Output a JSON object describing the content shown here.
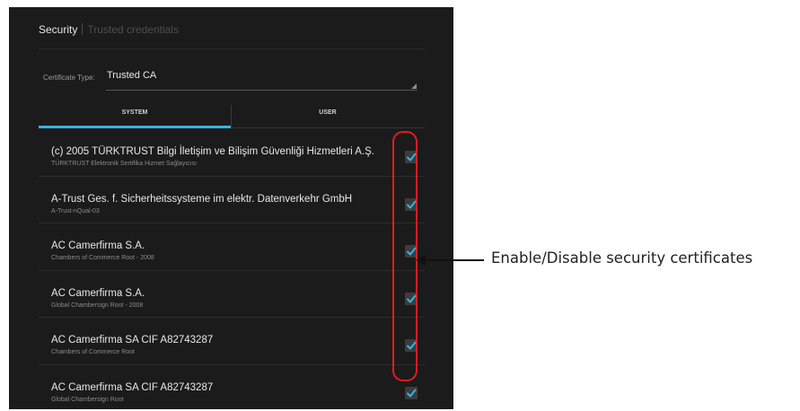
{
  "header": {
    "breadcrumb_current": "Security",
    "breadcrumb_next": "Trusted credentials"
  },
  "certificate_type": {
    "label": "Certificate Type:",
    "value": "Trusted CA"
  },
  "tabs": [
    {
      "label": "SYSTEM",
      "selected": true
    },
    {
      "label": "USER",
      "selected": false
    }
  ],
  "certificates": [
    {
      "title": "(c) 2005 TÜRKTRUST Bilgi İletişim ve Bilişim Güvenliği Hizmetleri A.Ş.",
      "subtitle": "TÜRKTRUST Elektronik Sertifika Hizmet Sağlayıcısı",
      "enabled": true
    },
    {
      "title": "A-Trust Ges. f. Sicherheitssysteme im elektr. Datenverkehr GmbH",
      "subtitle": "A-Trust-nQual-03",
      "enabled": true
    },
    {
      "title": "AC Camerfirma S.A.",
      "subtitle": "Chambers of Commerce Root - 2008",
      "enabled": true
    },
    {
      "title": "AC Camerfirma S.A.",
      "subtitle": "Global Chambersign Root - 2008",
      "enabled": true
    },
    {
      "title": "AC Camerfirma SA CIF A82743287",
      "subtitle": "Chambers of Commerce Root",
      "enabled": true
    },
    {
      "title": "AC Camerfirma SA CIF A82743287",
      "subtitle": "Global Chambersign Root",
      "enabled": true
    }
  ],
  "callout": {
    "text": "Enable/Disable security certificates"
  },
  "colors": {
    "accent": "#33b5e5",
    "highlight": "#e11b22",
    "background": "#1b1b1b"
  }
}
